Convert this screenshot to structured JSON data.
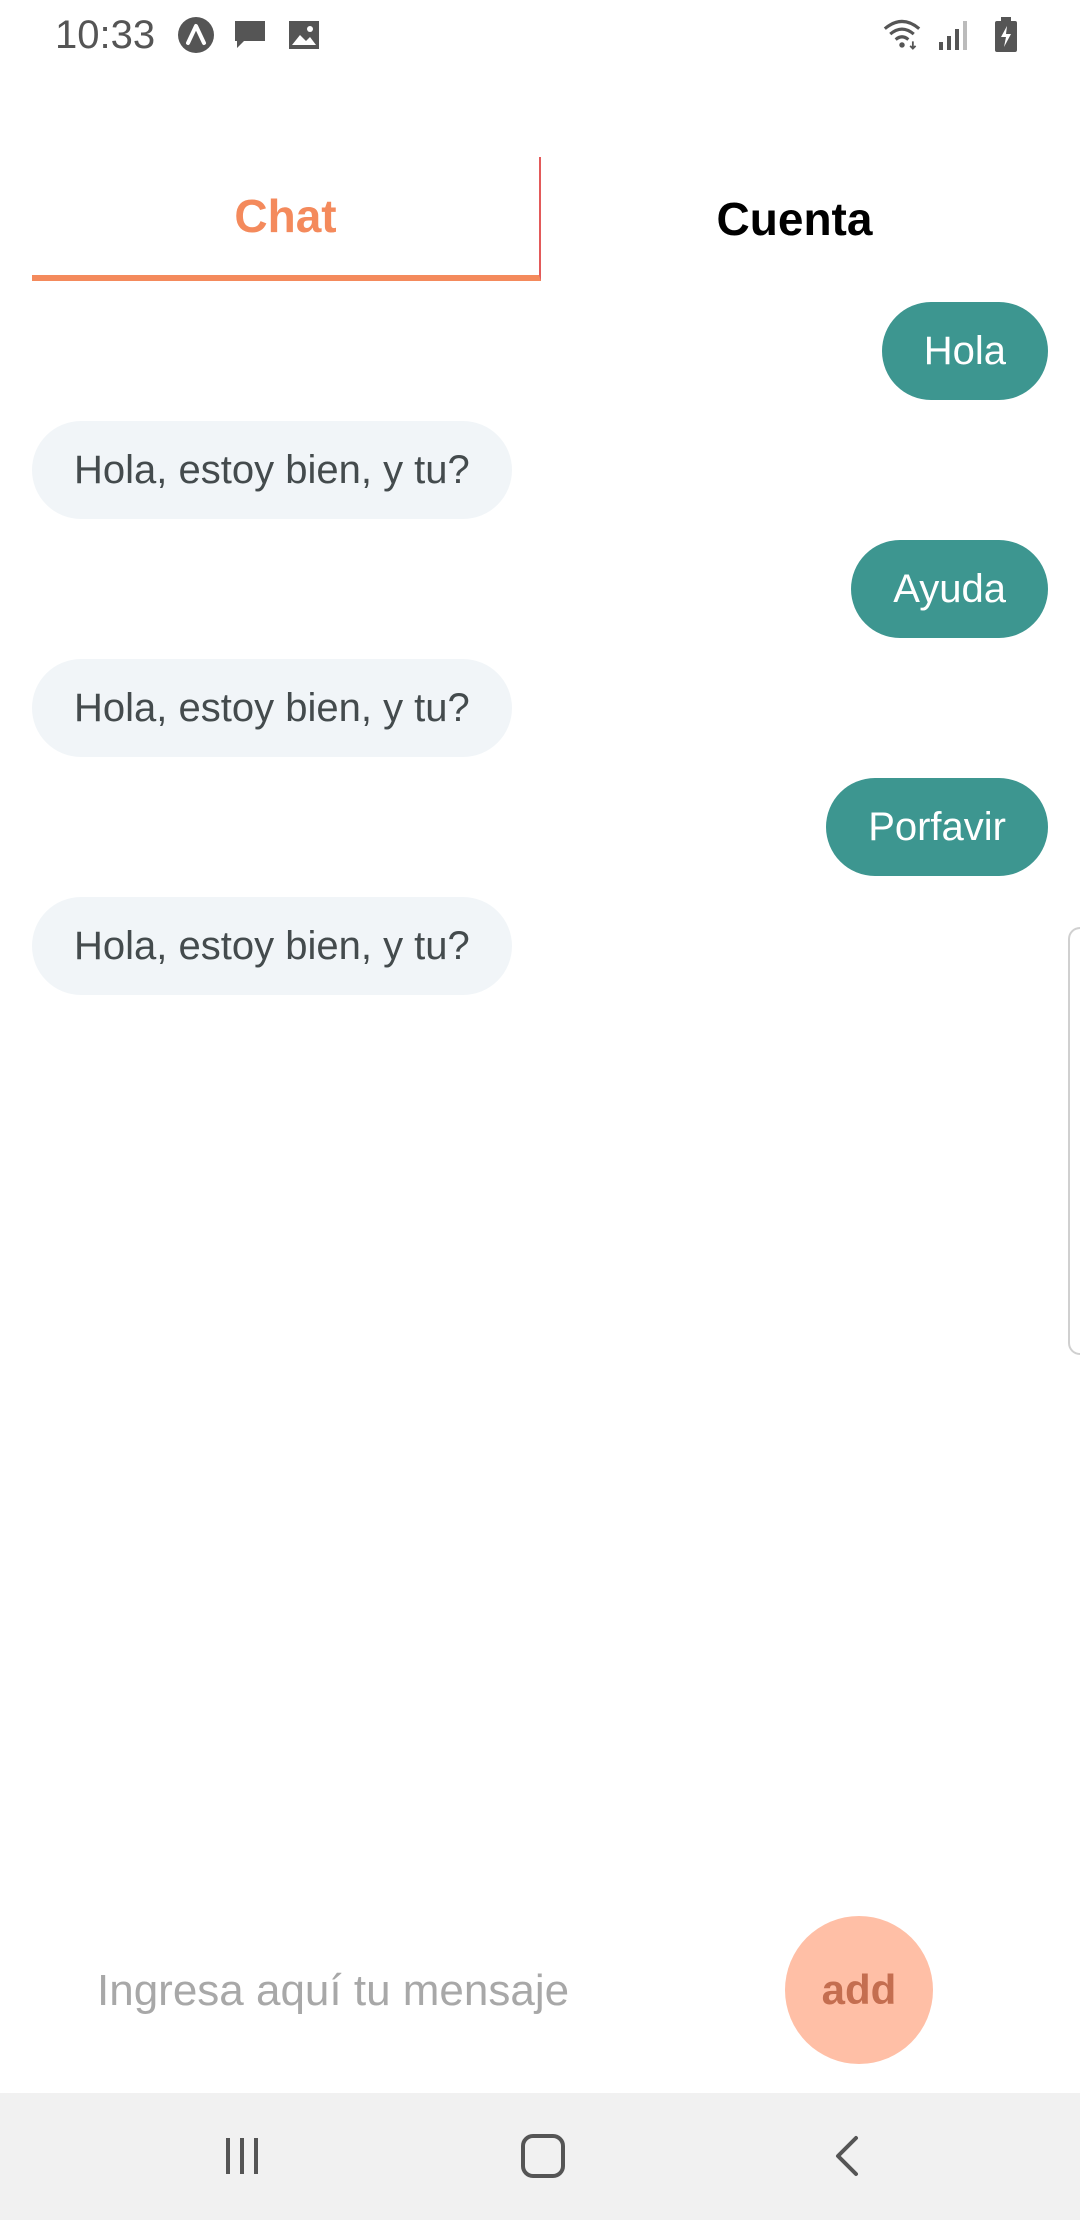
{
  "status_bar": {
    "time": "10:33",
    "left_icons": [
      "app-a-icon",
      "message-icon",
      "image-icon"
    ],
    "right_icons": [
      "wifi-icon",
      "signal-icon",
      "battery-icon"
    ]
  },
  "tabs": [
    {
      "label": "Chat",
      "active": true
    },
    {
      "label": "Cuenta",
      "active": false
    }
  ],
  "messages": [
    {
      "text": "Hola",
      "direction": "sent"
    },
    {
      "text": "Hola, estoy bien, y tu?",
      "direction": "received"
    },
    {
      "text": "Ayuda",
      "direction": "sent"
    },
    {
      "text": "Hola, estoy bien, y tu?",
      "direction": "received"
    },
    {
      "text": "Porfavir",
      "direction": "sent"
    },
    {
      "text": "Hola, estoy bien, y tu?",
      "direction": "received"
    }
  ],
  "composer": {
    "placeholder": "Ingresa aquí tu mensaje",
    "value": "",
    "send_label": "add"
  },
  "nav_bar": {
    "buttons": [
      "recent-apps-icon",
      "home-icon",
      "back-icon"
    ]
  },
  "colors": {
    "accent": "#f48a5c",
    "sent_bubble": "#3d9690",
    "received_bubble": "#f1f5f8",
    "add_button": "#ffbfa6"
  }
}
